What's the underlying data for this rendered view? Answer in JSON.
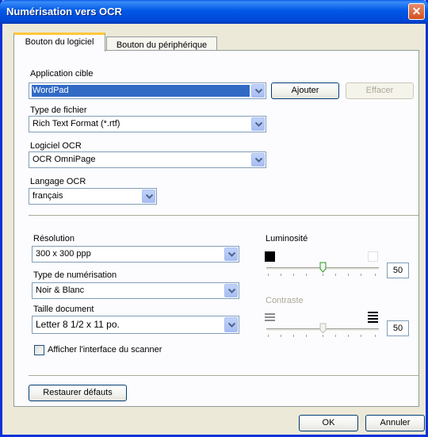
{
  "window": {
    "title": "Numérisation vers OCR"
  },
  "tabs": [
    {
      "label": "Bouton du logiciel",
      "active": true
    },
    {
      "label": "Bouton du périphérique",
      "active": false
    }
  ],
  "target_app": {
    "label": "Application cible",
    "value": "WordPad",
    "add_label": "Ajouter",
    "delete_label": "Effacer"
  },
  "file_type": {
    "label": "Type de fichier",
    "value": "Rich Text Format (*.rtf)"
  },
  "ocr_software": {
    "label": "Logiciel OCR",
    "value": "OCR OmniPage"
  },
  "ocr_language": {
    "label": "Langage OCR",
    "value": "français"
  },
  "resolution": {
    "label": "Résolution",
    "value": "300 x 300 ppp"
  },
  "scan_type": {
    "label": "Type de numérisation",
    "value": "Noir & Blanc"
  },
  "doc_size": {
    "label": "Taille document",
    "value": "Letter 8 1/2 x 11 po."
  },
  "brightness": {
    "label": "Luminosité",
    "value": "50",
    "level": 0.5
  },
  "contrast": {
    "label": "Contraste",
    "value": "50",
    "level": 0.5,
    "disabled": true
  },
  "show_scanner_ui": {
    "label": "Afficher l'interface du scanner",
    "checked": false
  },
  "restore_defaults_label": "Restaurer défauts",
  "ok_label": "OK",
  "cancel_label": "Annuler",
  "colors": {
    "title_bar": "#0058e6",
    "selection": "#316ac5",
    "active_tab_highlight": "#ffc83c",
    "close_button": "#d4501e"
  }
}
